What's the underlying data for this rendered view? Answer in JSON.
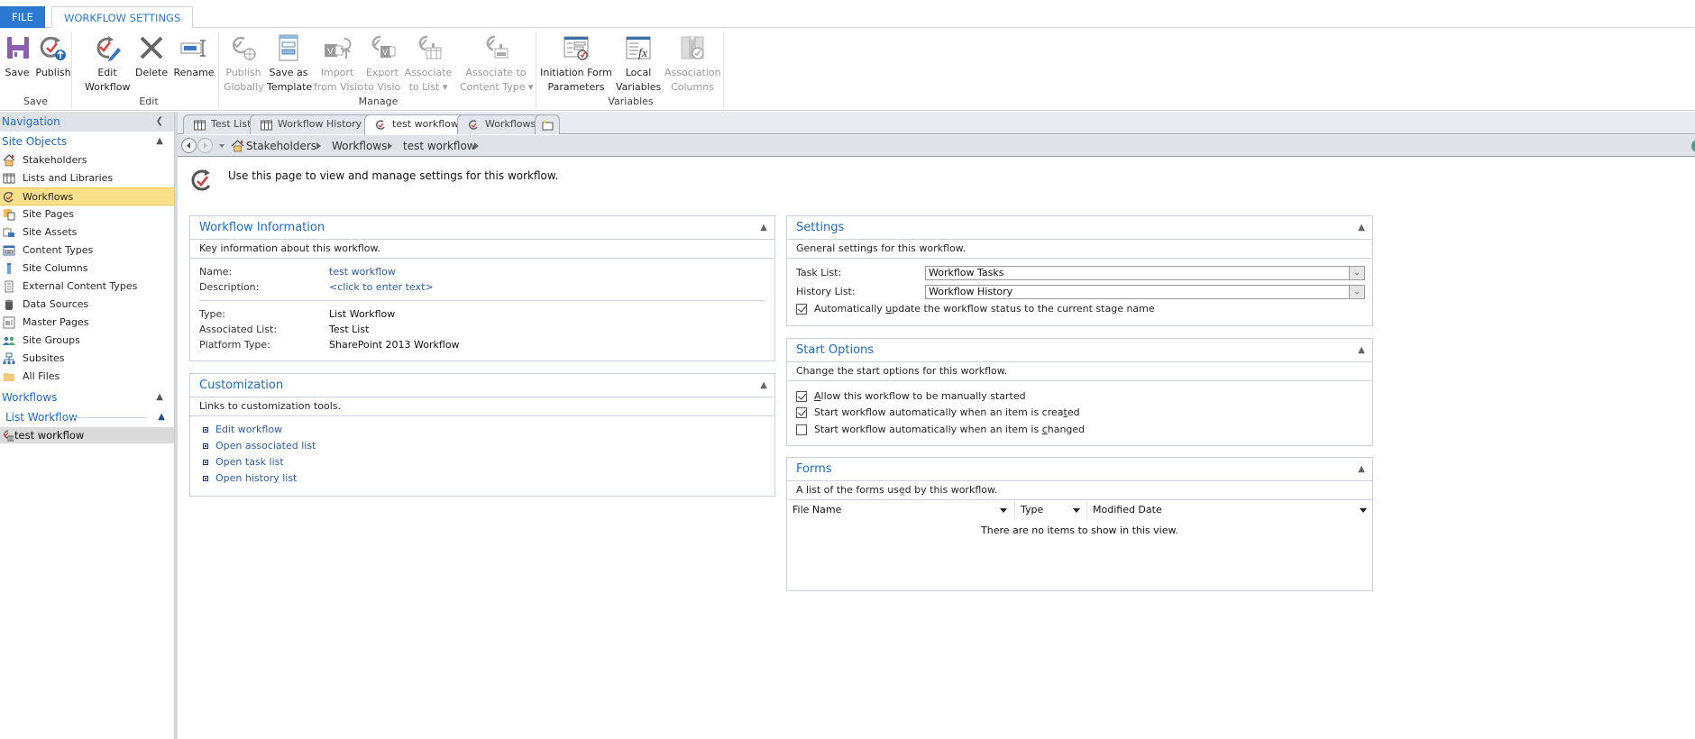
{
  "ribbon": {
    "tabs": [
      {
        "label": "FILE",
        "active": false
      },
      {
        "label": "WORKFLOW SETTINGS",
        "active": true
      }
    ],
    "groups": [
      {
        "label": "Save",
        "buttons": [
          {
            "label": "Save",
            "icon": "save-icon",
            "enabled": true
          },
          {
            "label": "Publish",
            "icon": "publish-icon",
            "enabled": true
          }
        ]
      },
      {
        "label": "Edit",
        "buttons": [
          {
            "label": "Edit\nWorkflow",
            "icon": "edit-workflow-icon",
            "enabled": true
          },
          {
            "label": "Delete",
            "icon": "delete-icon",
            "enabled": true
          },
          {
            "label": "Rename",
            "icon": "rename-icon",
            "enabled": true
          }
        ]
      },
      {
        "label": "Manage",
        "buttons": [
          {
            "label": "Publish\nGlobally",
            "icon": "publish-globally-icon",
            "enabled": false
          },
          {
            "label": "Save as\nTemplate",
            "icon": "save-template-icon",
            "enabled": true
          },
          {
            "label": "Import\nfrom Visio",
            "icon": "import-visio-icon",
            "enabled": false
          },
          {
            "label": "Export\nto Visio",
            "icon": "export-visio-icon",
            "enabled": false
          },
          {
            "label": "Associate\nto List ▾",
            "icon": "associate-list-icon",
            "enabled": false
          },
          {
            "label": "Associate to\nContent Type ▾",
            "icon": "associate-content-type-icon",
            "enabled": false
          }
        ]
      },
      {
        "label": "Variables",
        "buttons": [
          {
            "label": "Initiation Form\nParameters",
            "icon": "initiation-form-icon",
            "enabled": true
          },
          {
            "label": "Local\nVariables",
            "icon": "local-variables-icon",
            "enabled": true
          },
          {
            "label": "Association\nColumns",
            "icon": "association-columns-icon",
            "enabled": false
          }
        ]
      }
    ]
  },
  "nav": {
    "title": "Navigation",
    "site_objects_label": "Site Objects",
    "site_objects": [
      {
        "label": "Stakeholders",
        "icon": "home-icon",
        "active": false
      },
      {
        "label": "Lists and Libraries",
        "icon": "list-icon",
        "active": false
      },
      {
        "label": "Workflows",
        "icon": "workflow-icon",
        "active": true
      },
      {
        "label": "Site Pages",
        "icon": "site-pages-icon",
        "active": false
      },
      {
        "label": "Site Assets",
        "icon": "site-assets-icon",
        "active": false
      },
      {
        "label": "Content Types",
        "icon": "content-types-icon",
        "active": false
      },
      {
        "label": "Site Columns",
        "icon": "site-columns-icon",
        "active": false
      },
      {
        "label": "External Content Types",
        "icon": "external-content-icon",
        "active": false
      },
      {
        "label": "Data Sources",
        "icon": "database-icon",
        "active": false
      },
      {
        "label": "Master Pages",
        "icon": "master-pages-icon",
        "active": false
      },
      {
        "label": "Site Groups",
        "icon": "groups-icon",
        "active": false
      },
      {
        "label": "Subsites",
        "icon": "subsites-icon",
        "active": false
      },
      {
        "label": "All Files",
        "icon": "folder-icon",
        "active": false
      }
    ],
    "workflows_label": "Workflows",
    "list_workflow_label": "List Workflow",
    "workflow_items": [
      {
        "label": "test workflow"
      }
    ]
  },
  "doc_tabs": [
    {
      "label": "Test List",
      "icon": "list-icon",
      "active": false
    },
    {
      "label": "Workflow History",
      "icon": "list-icon",
      "active": false
    },
    {
      "label": "test workflow",
      "icon": "workflow-icon",
      "active": true
    },
    {
      "label": "Workflows",
      "icon": "workflow-icon",
      "active": false
    }
  ],
  "breadcrumb": [
    "Stakeholders",
    "Workflows",
    "test workflow"
  ],
  "intro": "Use this page to view and manage settings for this workflow.",
  "workflow_info": {
    "title": "Workflow Information",
    "desc": "Key information about this workflow.",
    "name_label": "Name:",
    "name_value": "test workflow",
    "description_label": "Description:",
    "description_value": "<click to enter text>",
    "type_label": "Type:",
    "type_value": "List Workflow",
    "assoc_label": "Associated List:",
    "assoc_value": "Test List",
    "platform_label": "Platform Type:",
    "platform_value": "SharePoint 2013 Workflow"
  },
  "customization": {
    "title": "Customization",
    "desc": "Links to customization tools.",
    "links": [
      "Edit workflow",
      "Open associated list",
      "Open task list",
      "Open history list"
    ]
  },
  "settings": {
    "title": "Settings",
    "desc": "General settings for this workflow.",
    "task_list_label": "Task List:",
    "task_list_value": "Workflow Tasks",
    "history_list_label": "History List:",
    "history_list_value": "Workflow History",
    "auto_update": {
      "pre": "Automatically ",
      "accel": "u",
      "post": "pdate the workflow status to the current stage name",
      "checked": true
    }
  },
  "start_options": {
    "title": "Start Options",
    "desc": "Change the start options for this workflow.",
    "options": [
      {
        "pre": "",
        "accel": "A",
        "post": "llow this workflow to be manually started",
        "checked": true
      },
      {
        "pre": "Start workflow automatically when an item is crea",
        "accel": "t",
        "post": "ed",
        "checked": true
      },
      {
        "pre": "Start workflow automatically when an item is ",
        "accel": "c",
        "post": "hanged",
        "checked": false
      }
    ]
  },
  "forms": {
    "title": "Forms",
    "desc": "A list of the forms used by this workflow.",
    "columns": [
      "File Name",
      "Type",
      "Modified Date"
    ],
    "empty_text": "There are no items to show in this view."
  }
}
